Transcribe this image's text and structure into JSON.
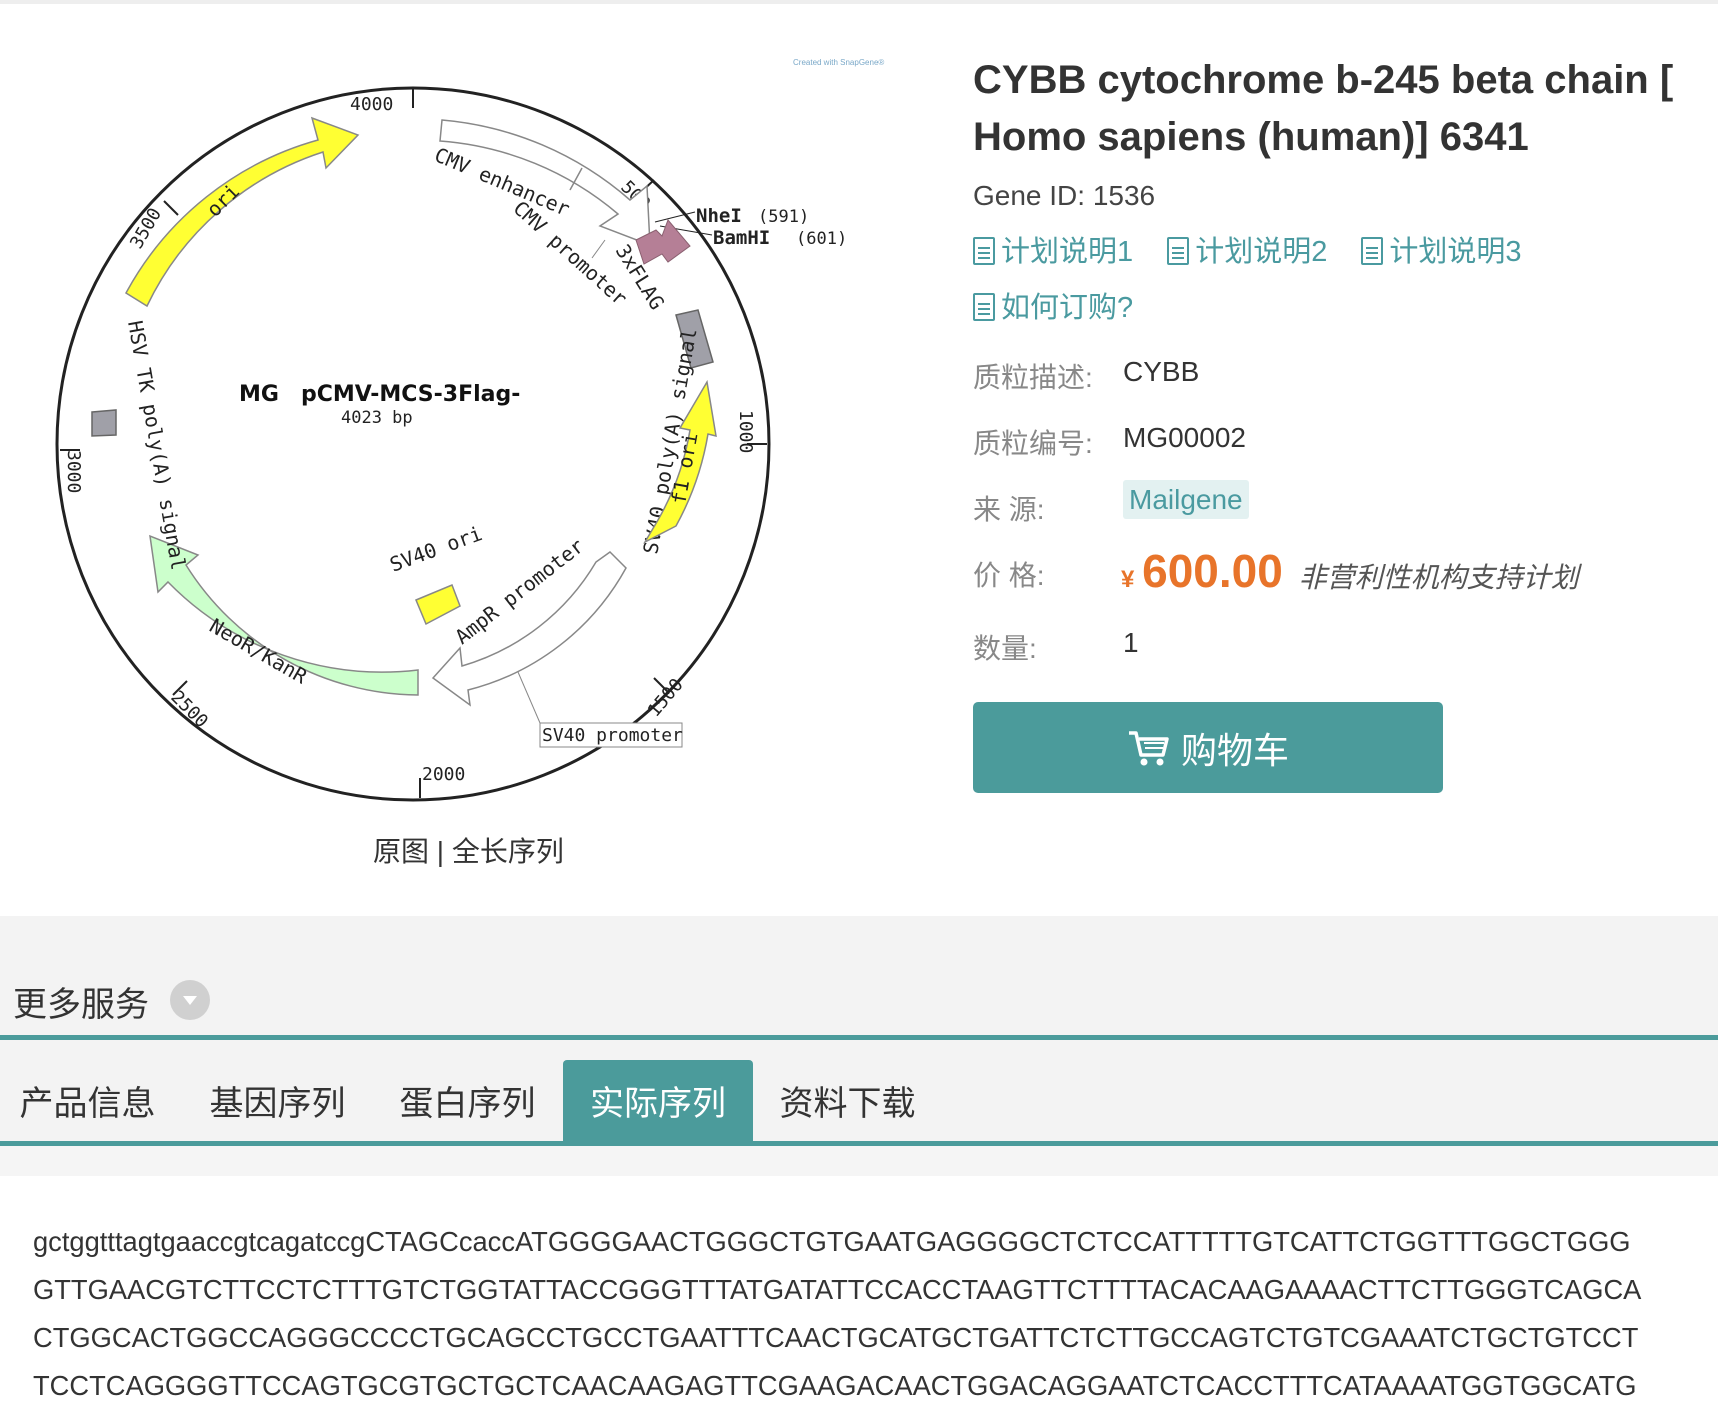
{
  "plasmid_map": {
    "watermark": "Created with SnapGene®",
    "name_prefix": "MG",
    "name": "pCMV-MCS-3Flag-",
    "size": "4023 bp",
    "ticks": [
      "4000",
      "500",
      "1000",
      "1500",
      "2000",
      "2500",
      "3000",
      "3500"
    ],
    "features": [
      "ori",
      "CMV enhancer",
      "CMV promoter",
      "3xFLAG",
      "SV40 poly(A) signal",
      "f1 ori",
      "SV40 ori",
      "AmpR promoter",
      "NeoR/KanR",
      "HSV TK poly(A) signal",
      "SV40 promoter"
    ],
    "sites": [
      {
        "name": "NheI",
        "pos": "(591)"
      },
      {
        "name": "BamHI",
        "pos": "(601)"
      }
    ],
    "colors": {
      "ori": "#ffff33",
      "f1_ori": "#ffff33",
      "neo": "#ccffcc",
      "flag": "#b57f96",
      "polya": "#a0a0a8"
    }
  },
  "map_links": {
    "original": "原图",
    "sep": "|",
    "full_seq": "全长序列"
  },
  "product": {
    "title": "CYBB cytochrome b-245 beta chain [ Homo sapiens (human)] 6341",
    "gene_id": "Gene ID: 1536",
    "docs": [
      "计划说明1",
      "计划说明2",
      "计划说明3",
      "如何订购?"
    ],
    "fields": {
      "desc_label": "质粒描述:",
      "desc_value": "CYBB",
      "code_label": "质粒编号:",
      "code_value": "MG00002",
      "source_label": "来 源:",
      "source_value": "Mailgene",
      "price_label": "价 格:",
      "price_currency": "¥",
      "price_value": "600.00",
      "price_note": "非营利性机构支持计划",
      "qty_label": "数量:",
      "qty_value": "1"
    },
    "cart_label": "购物车"
  },
  "more_services": "更多服务",
  "tabs": [
    "产品信息",
    "基因序列",
    "蛋白序列",
    "实际序列",
    "资料下载"
  ],
  "active_tab": "实际序列",
  "sequence_lines": [
    "gctggtttagtgaaccgtcagatccgCTAGCcaccATGGGGAACTGGGCTGTGAATGAGGGGCTCTCCATTTTTGTCATTCTGGTTTGGCTGGG",
    "GTTGAACGTCTTCCTCTTTGTCTGGTATTACCGGGTTTATGATATTCCACCTAAGTTCTTTTACACAAGAAAACTTCTTGGGTCAGCA",
    "CTGGCACTGGCCAGGGCCCCTGCAGCCTGCCTGAATTTCAACTGCATGCTGATTCTCTTGCCAGTCTGTCGAAATCTGCTGTCCT",
    "TCCTCAGGGGTTCCAGTGCGTGCTGCTCAACAAGAGTTCGAAGACAACTGGACAGGAATCTCACCTTTCATAAAATGGTGGCATG"
  ]
}
